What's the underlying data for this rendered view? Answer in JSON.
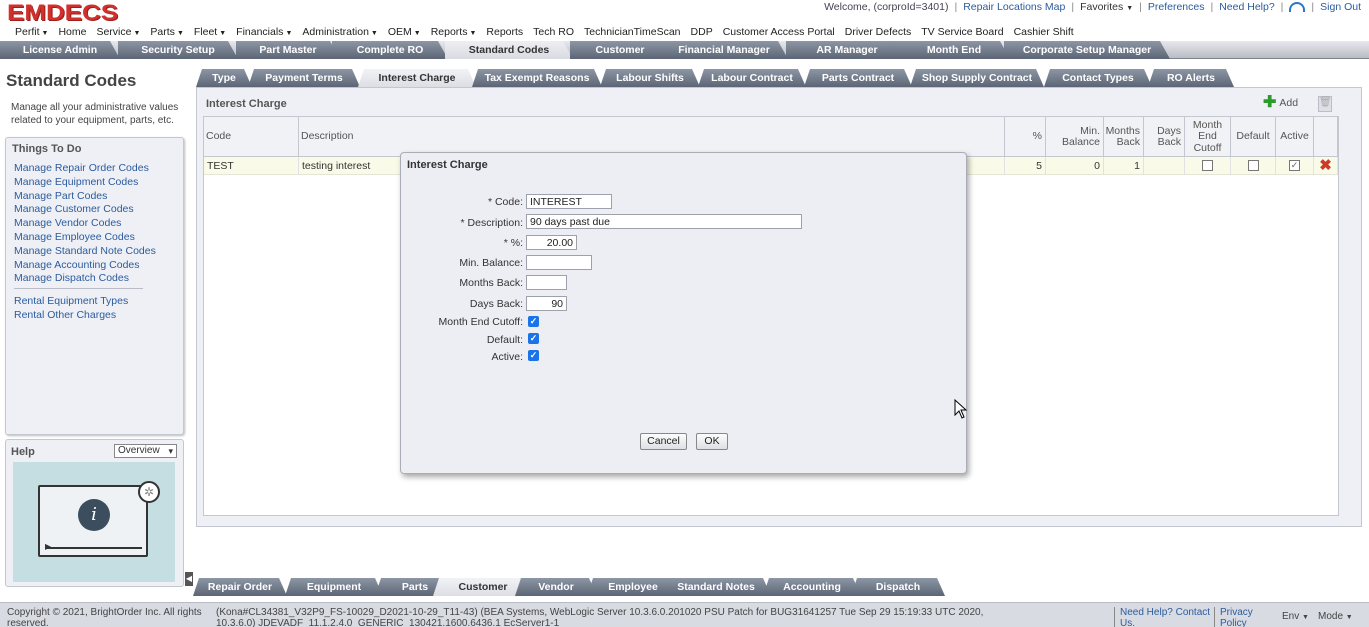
{
  "header": {
    "logo": "EMDECS",
    "welcome": "Welcome, (corproId=3401)",
    "repair_locations": "Repair Locations Map",
    "favorites": "Favorites",
    "preferences": "Preferences",
    "need_help": "Need Help?",
    "sign_out": "Sign Out"
  },
  "menu": [
    "Perfit",
    "Home",
    "Service",
    "Parts",
    "Fleet",
    "Financials",
    "Administration",
    "OEM",
    "Reports",
    "Reports",
    "Tech RO",
    "TechnicianTimeScan",
    "DDP",
    "Customer Access Portal",
    "Driver Defects",
    "TV Service Board",
    "Cashier Shift"
  ],
  "menu_caret": [
    true,
    false,
    true,
    true,
    true,
    true,
    true,
    true,
    true,
    false,
    false,
    false,
    false,
    false,
    false,
    false,
    false
  ],
  "app_tabs": [
    "License Admin",
    "Security Setup",
    "Part Master",
    "Complete RO",
    "Standard Codes",
    "Customer",
    "Financial Manager",
    "AR Manager",
    "Month End",
    "Corporate Setup Manager"
  ],
  "sidebar": {
    "title": "Standard Codes",
    "description": "Manage all your administrative values related to your equipment, parts, etc.",
    "todo_title": "Things To Do",
    "todo_items": [
      "Manage Repair Order Codes",
      "Manage Equipment Codes",
      "Manage Part Codes",
      "Manage Customer Codes",
      "Manage Vendor Codes",
      "Manage Employee Codes",
      "Manage Standard Note Codes",
      "Manage Accounting Codes",
      "Manage Dispatch Codes"
    ],
    "todo_items2": [
      "Rental Equipment Types",
      "Rental Other Charges"
    ],
    "help_title": "Help",
    "help_select": "Overview"
  },
  "sub_tabs": [
    "Type",
    "Payment Terms",
    "Interest Charge",
    "Tax Exempt Reasons",
    "Labour Shifts",
    "Labour Contract",
    "Parts Contract",
    "Shop Supply Contract",
    "Contact Types",
    "RO Alerts"
  ],
  "panel": {
    "title": "Interest Charge",
    "add_label": "Add",
    "columns": [
      "Code",
      "Description",
      "%",
      "Min. Balance",
      "Months Back",
      "Days Back",
      "Month End Cutoff",
      "Default",
      "Active"
    ],
    "rows": [
      {
        "code": "TEST",
        "description": "testing interest",
        "pct": "5",
        "min_balance": "0",
        "months_back": "1",
        "days_back": "",
        "month_end_cutoff": false,
        "default": false,
        "active": true
      }
    ]
  },
  "bottom_tabs": [
    "Repair Order",
    "Equipment",
    "Parts",
    "Customer",
    "Vendor",
    "Employee",
    "Standard Notes",
    "Accounting",
    "Dispatch"
  ],
  "footer": {
    "copyright": "Copyright © 2021, BrightOrder Inc. All rights reserved.",
    "version": "(Kona#CL34381_V32P9_FS-10029_D2021-10-29_T11-43) (BEA Systems, WebLogic Server 10.3.6.0.201020 PSU Patch for BUG31641257 Tue Sep 29 15:19:33 UTC 2020, 10.3.6.0) JDEVADF_11.1.2.4.0_GENERIC_130421.1600.6436.1 EcServer1-1",
    "help_contact": "Need Help? Contact Us.",
    "privacy": "Privacy Policy",
    "env": "Env",
    "mode": "Mode"
  },
  "modal": {
    "title": "Interest Charge",
    "code_label": "* Code:",
    "code_value": "INTEREST",
    "description_label": "* Description:",
    "description_value": "90 days past due",
    "pct_label": "* %:",
    "pct_value": "20.00",
    "min_balance_label": "Min. Balance:",
    "min_balance_value": "",
    "months_back_label": "Months Back:",
    "months_back_value": "",
    "days_back_label": "Days Back:",
    "days_back_value": "90",
    "month_end_cutoff_label": "Month End Cutoff:",
    "month_end_cutoff": true,
    "default_label": "Default:",
    "default": true,
    "active_label": "Active:",
    "active": true,
    "cancel": "Cancel",
    "ok": "OK"
  },
  "colors": {
    "logo": "#d0312d",
    "tab_gradient_top": "#8c96a4",
    "tab_gradient_bottom": "#5c6575",
    "link": "#2b5c9e",
    "checkbox_checked": "#1a73e8",
    "delete_icon": "#d03a28",
    "add_icon": "#2d9a2b"
  }
}
